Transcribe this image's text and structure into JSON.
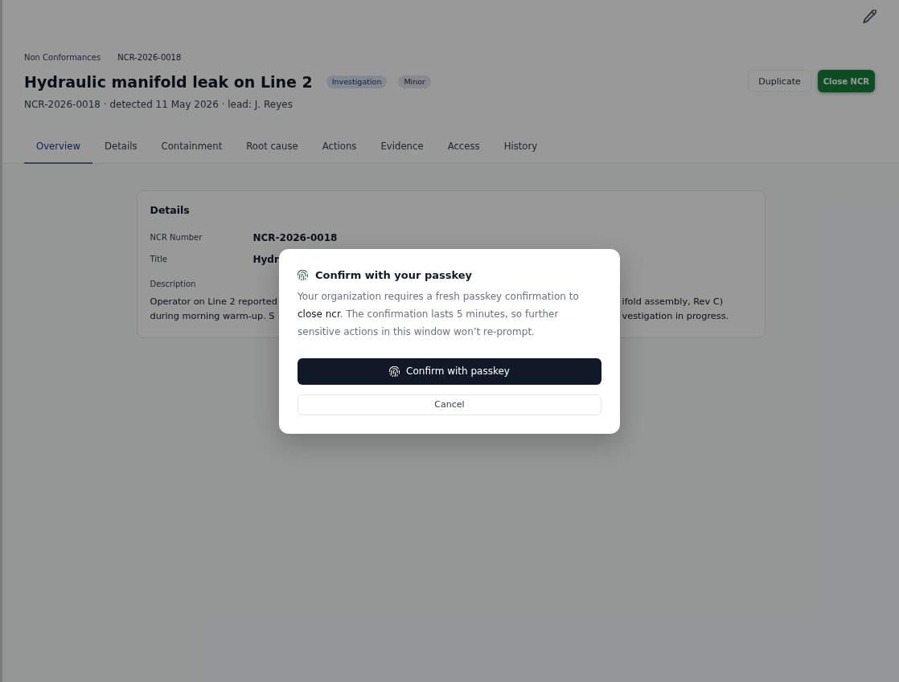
{
  "page": {
    "breadcrumb": [
      {
        "label": "Non Conformances",
        "kind": "link"
      },
      {
        "label": "NCR-2026-0018",
        "kind": "current"
      }
    ],
    "title": "Hydraulic manifold leak on Line 2",
    "badges": [
      {
        "label": "Investigation",
        "kind": "status"
      },
      {
        "label": "Minor",
        "kind": "severity"
      }
    ],
    "meta": "NCR-2026-0018 · detected 11 May 2026 · lead: J. Reyes",
    "actions": [
      {
        "label": "Duplicate",
        "kind": "secondary"
      },
      {
        "label": "Close NCR",
        "kind": "primary"
      }
    ],
    "tabs": [
      {
        "label": "Overview",
        "selected": true
      },
      {
        "label": "Details",
        "selected": false
      },
      {
        "label": "Containment",
        "selected": false
      },
      {
        "label": "Root cause",
        "selected": false
      },
      {
        "label": "Actions",
        "selected": false
      },
      {
        "label": "Evidence",
        "selected": false
      },
      {
        "label": "Access",
        "selected": false
      },
      {
        "label": "History",
        "selected": false
      }
    ],
    "details_card": {
      "heading": "Details",
      "fields": [
        {
          "label": "NCR Number",
          "value": "NCR-2026-0018"
        },
        {
          "label": "Title",
          "value": "Hydr"
        }
      ],
      "description_label": "Description",
      "description_lines": [
        {
          "start": "Operator on Line 2 reported",
          "end": "ifold assembly, Rev C)"
        },
        {
          "start": "during morning warm-up. S",
          "end": "vestigation in progress."
        }
      ]
    }
  },
  "dialog": {
    "title": "Confirm with your passkey",
    "message": "Your organization requires a fresh passkey confirmation to **close ncr**. The confirmation lasts 5 minutes, so further sensitive actions in this window won’t re-prompt.",
    "buttons": [
      {
        "label": "Confirm with passkey",
        "kind": "primary"
      },
      {
        "label": "Cancel",
        "kind": "secondary"
      }
    ]
  }
}
